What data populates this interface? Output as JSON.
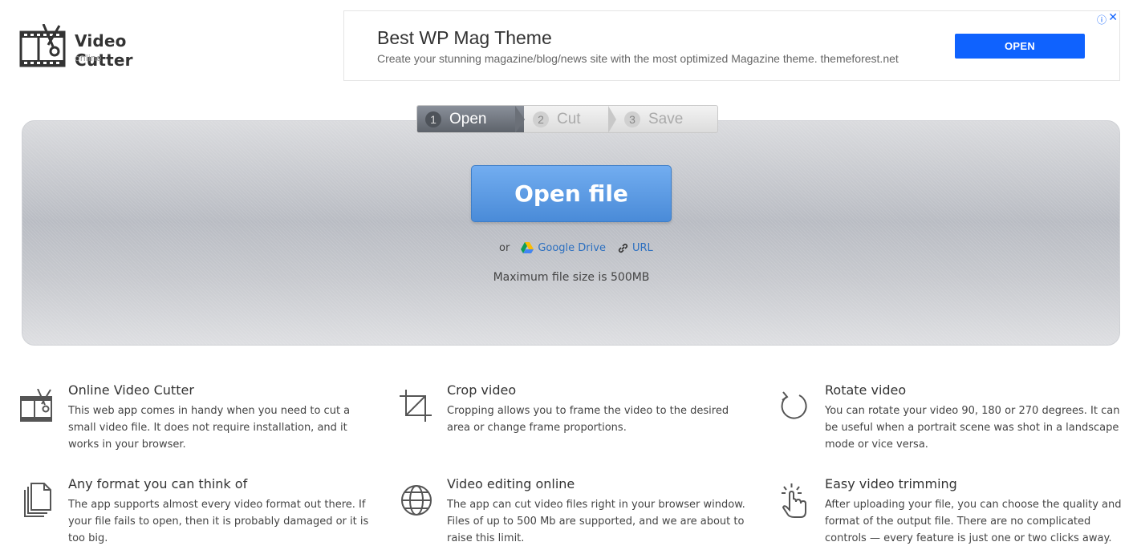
{
  "logo": {
    "title": "Video Cutter",
    "subtitle": "online"
  },
  "ad": {
    "title": "Best WP Mag Theme",
    "description": "Create your stunning magazine/blog/news site with the most optimized Magazine theme. themeforest.net",
    "button": "OPEN",
    "info_icon": "ⓘ",
    "close_icon": "✕"
  },
  "steps": [
    {
      "num": "1",
      "label": "Open"
    },
    {
      "num": "2",
      "label": "Cut"
    },
    {
      "num": "3",
      "label": "Save"
    }
  ],
  "upload": {
    "button": "Open file",
    "or": "or",
    "google_drive": "Google Drive",
    "url": "URL",
    "max_size": "Maximum file size is 500MB"
  },
  "features": [
    {
      "icon": "film-scissors-icon",
      "title": "Online Video Cutter",
      "text": "This web app comes in handy when you need to cut a small video file. It does not require installation, and it works in your browser."
    },
    {
      "icon": "crop-icon",
      "title": "Crop video",
      "text": "Cropping allows you to frame the video to the desired area or change frame proportions."
    },
    {
      "icon": "rotate-icon",
      "title": "Rotate video",
      "text": "You can rotate your video 90, 180 or 270 degrees. It can be useful when a portrait scene was shot in a landscape mode or vice versa."
    },
    {
      "icon": "files-icon",
      "title": "Any format you can think of",
      "text": "The app supports almost every video format out there. If your file fails to open, then it is probably damaged or it is too big."
    },
    {
      "icon": "globe-icon",
      "title": "Video editing online",
      "text": "The app can cut video files right in your browser window. Files of up to 500 Mb are supported, and we are about to raise this limit."
    },
    {
      "icon": "hand-click-icon",
      "title": "Easy video trimming",
      "text": "After uploading your file, you can choose the quality and format of the output file. There are no complicated controls — every feature is just one or two clicks away."
    }
  ],
  "colors": {
    "accent": "#4a8bd8",
    "ad_button": "#0f62fe",
    "link": "#2b6fc0"
  }
}
